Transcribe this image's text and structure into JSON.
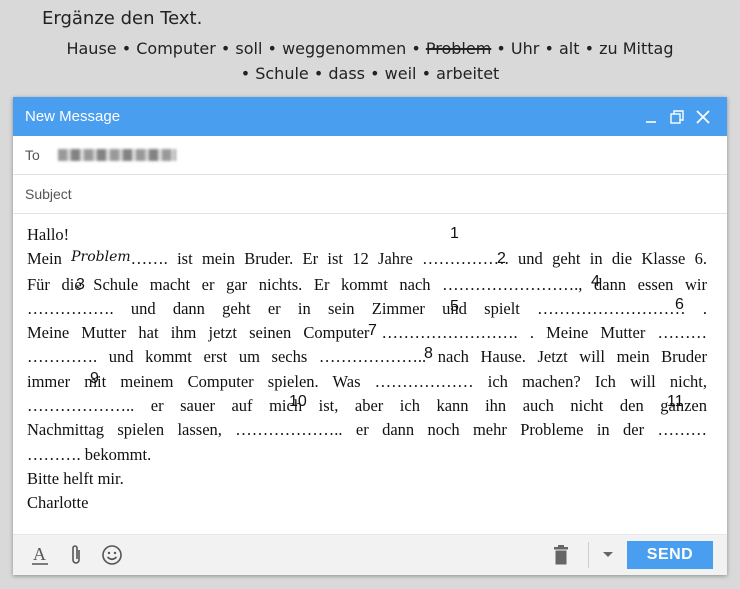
{
  "instruction": "Ergänze den Text.",
  "word_bank": {
    "line1": [
      "Hause",
      "Computer",
      "soll",
      "weggenommen",
      "Problem",
      "Uhr",
      "alt",
      "zu Mittag"
    ],
    "line2": [
      "Schule",
      "dass",
      "weil",
      "arbeitet"
    ],
    "separator": "•",
    "struck_word": "Problem"
  },
  "window": {
    "title": "New Message",
    "to_label": "To",
    "subject_label": "Subject",
    "send_label": "SEND"
  },
  "letter": {
    "greeting": "Hallo!",
    "l1a": "Mein ",
    "l1_handwritten": "Problem",
    "l1b": "……. ist mein Bruder. Er ist 12 Jahre ……………. und geht in die Klasse 6.",
    "l2": "Für die Schule macht er gar nichts. Er kommt nach ……………………., dann essen wir",
    "l3": "……………. und dann geht er in sein Zimmer und spielt ……………………… .",
    "l4": "Meine Mutter hat ihm jetzt seinen Computer ……………………. . Meine Mutter ………",
    "l5": "…………. und kommt erst um sechs ……………….. nach Hause. Jetzt will mein Bruder",
    "l6": "immer mit meinem Computer spielen. Was ……………… ich machen? Ich will nicht,",
    "l7": "……………….. er sauer auf mich ist, aber ich kann ihn auch nicht den ganzen",
    "l8": "Nachmittag spielen lassen, ……………….. er dann noch mehr Probleme in der ………",
    "l9": "………. bekommt.",
    "closing": "Bitte helft mir.",
    "signature": "Charlotte",
    "blank_numbers": [
      "1",
      "2",
      "3",
      "4",
      "5",
      "6",
      "7",
      "8",
      "9",
      "10",
      "11"
    ]
  }
}
